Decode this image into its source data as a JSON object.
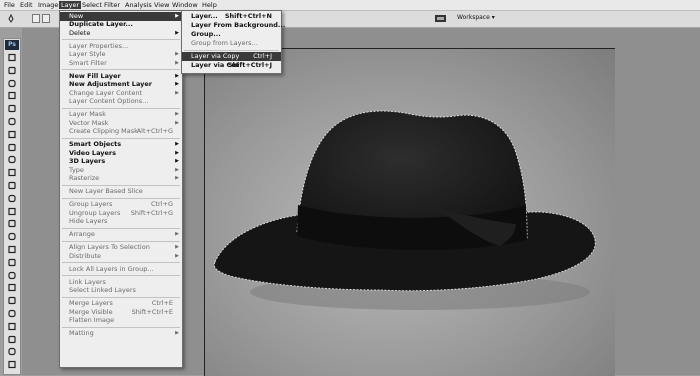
{
  "menubar": [
    "File",
    "Edit",
    "Image",
    "Layer",
    "Select",
    "Filter",
    "Analysis",
    "View",
    "Window",
    "Help"
  ],
  "options": {
    "workspace_label": "Workspace ▾"
  },
  "layer_menu": [
    {
      "label": "New",
      "arrow": true,
      "hl": true
    },
    {
      "label": "Duplicate Layer...",
      "bold": true
    },
    {
      "label": "Delete",
      "arrow": true
    },
    {
      "sep": true
    },
    {
      "label": "Layer Properties...",
      "disabled": true
    },
    {
      "label": "Layer Style",
      "arrow": true,
      "disabled": true
    },
    {
      "label": "Smart Filter",
      "arrow": true,
      "disabled": true
    },
    {
      "sep": true
    },
    {
      "label": "New Fill Layer",
      "arrow": true,
      "bold": true
    },
    {
      "label": "New Adjustment Layer",
      "arrow": true,
      "bold": true
    },
    {
      "label": "Change Layer Content",
      "arrow": true,
      "disabled": true
    },
    {
      "label": "Layer Content Options...",
      "disabled": true
    },
    {
      "sep": true
    },
    {
      "label": "Layer Mask",
      "arrow": true,
      "disabled": true
    },
    {
      "label": "Vector Mask",
      "arrow": true,
      "disabled": true
    },
    {
      "label": "Create Clipping Mask",
      "shortcut": "Alt+Ctrl+G",
      "disabled": true
    },
    {
      "sep": true
    },
    {
      "label": "Smart Objects",
      "arrow": true,
      "bold": true
    },
    {
      "label": "Video Layers",
      "arrow": true,
      "bold": true
    },
    {
      "label": "3D Layers",
      "arrow": true,
      "bold": true
    },
    {
      "label": "Type",
      "arrow": true,
      "disabled": true
    },
    {
      "label": "Rasterize",
      "arrow": true,
      "disabled": true
    },
    {
      "sep": true
    },
    {
      "label": "New Layer Based Slice",
      "disabled": true
    },
    {
      "sep": true
    },
    {
      "label": "Group Layers",
      "shortcut": "Ctrl+G",
      "disabled": true
    },
    {
      "label": "Ungroup Layers",
      "shortcut": "Shift+Ctrl+G",
      "disabled": true
    },
    {
      "label": "Hide Layers",
      "disabled": true
    },
    {
      "sep": true
    },
    {
      "label": "Arrange",
      "arrow": true,
      "disabled": true
    },
    {
      "sep": true
    },
    {
      "label": "Align Layers To Selection",
      "arrow": true,
      "disabled": true
    },
    {
      "label": "Distribute",
      "arrow": true,
      "disabled": true
    },
    {
      "sep": true
    },
    {
      "label": "Lock All Layers in Group...",
      "disabled": true
    },
    {
      "sep": true
    },
    {
      "label": "Link Layers",
      "disabled": true
    },
    {
      "label": "Select Linked Layers",
      "disabled": true
    },
    {
      "sep": true
    },
    {
      "label": "Merge Layers",
      "shortcut": "Ctrl+E",
      "disabled": true
    },
    {
      "label": "Merge Visible",
      "shortcut": "Shift+Ctrl+E",
      "disabled": true
    },
    {
      "label": "Flatten Image",
      "disabled": true
    },
    {
      "sep": true
    },
    {
      "label": "Matting",
      "arrow": true,
      "disabled": true
    }
  ],
  "new_submenu": [
    {
      "label": "Layer...",
      "shortcut": "Shift+Ctrl+N",
      "bold": true
    },
    {
      "label": "Layer From Background...",
      "bold": true
    },
    {
      "label": "Group...",
      "bold": true
    },
    {
      "label": "Group from Layers...",
      "disabled": true
    },
    {
      "sep": true
    },
    {
      "label": "Layer via Copy",
      "shortcut": "Ctrl+J",
      "hl": true
    },
    {
      "label": "Layer via Cut",
      "shortcut": "Shift+Ctrl+J",
      "bold": true
    }
  ],
  "colors": {
    "menu_bg": "#eeeeee",
    "highlight": "#3a3a3a",
    "canvas": "#9e9e9e"
  }
}
